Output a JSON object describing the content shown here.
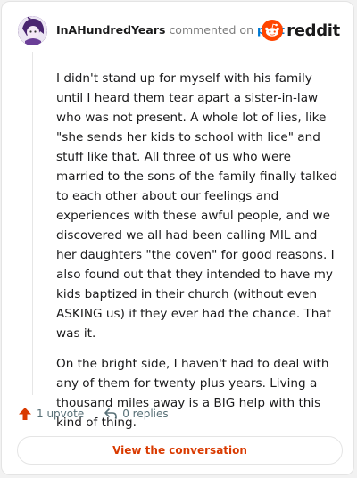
{
  "header": {
    "username": "InAHundredYears",
    "action_text": "commented on",
    "post_link": "post",
    "brand": "reddit"
  },
  "comment": {
    "paragraphs": [
      "I didn't stand up for myself with his family until I heard them tear apart a sister-in-law who was not present. A whole lot of lies, like \"she sends her kids to school with lice\" and stuff like that. All three of us who were married to the sons of the family finally talked to each other about our feelings and experiences with these awful people, and we discovered we all had been calling MIL and her daughters \"the coven\" for good reasons. I also found out that they intended to have my kids baptized in their church (without even ASKING us) if they ever had the chance. That was it.",
      "On the bright side, I haven't had to deal with any of them for twenty plus years. Living a thousand miles away is a BIG help with this kind of thing."
    ]
  },
  "actions": {
    "upvote_label": "1 upvote",
    "replies_label": "0 replies"
  },
  "cta": {
    "label": "View the conversation"
  },
  "colors": {
    "brand_orange": "#ff4500",
    "upvote_red": "#d93a00",
    "link_blue": "#0079d3"
  },
  "icons": {
    "upvote": "arrow-up-icon",
    "reply": "reply-arrow-icon",
    "logo": "reddit-snoo-icon"
  }
}
